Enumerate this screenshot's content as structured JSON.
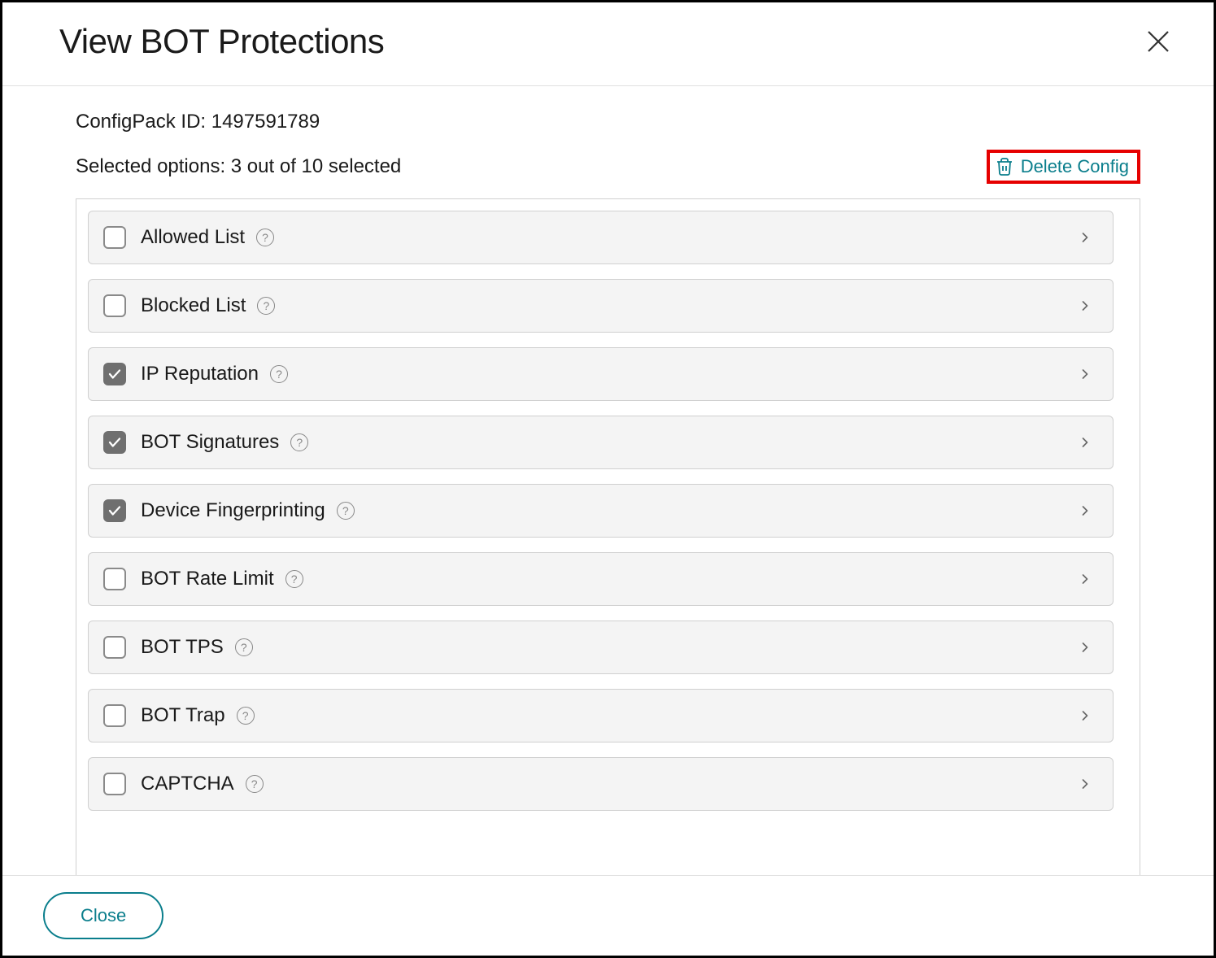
{
  "modal": {
    "title": "View BOT Protections",
    "configpack_label": "ConfigPack ID: 1497591789",
    "selected_label": "Selected options: 3 out of 10 selected",
    "delete_label": "Delete Config",
    "close_label": "Close"
  },
  "options": [
    {
      "label": "Allowed List",
      "checked": false
    },
    {
      "label": "Blocked List",
      "checked": false
    },
    {
      "label": "IP Reputation",
      "checked": true
    },
    {
      "label": "BOT Signatures",
      "checked": true
    },
    {
      "label": "Device Fingerprinting",
      "checked": true
    },
    {
      "label": "BOT Rate Limit",
      "checked": false
    },
    {
      "label": "BOT TPS",
      "checked": false
    },
    {
      "label": "BOT Trap",
      "checked": false
    },
    {
      "label": "CAPTCHA",
      "checked": false
    }
  ]
}
